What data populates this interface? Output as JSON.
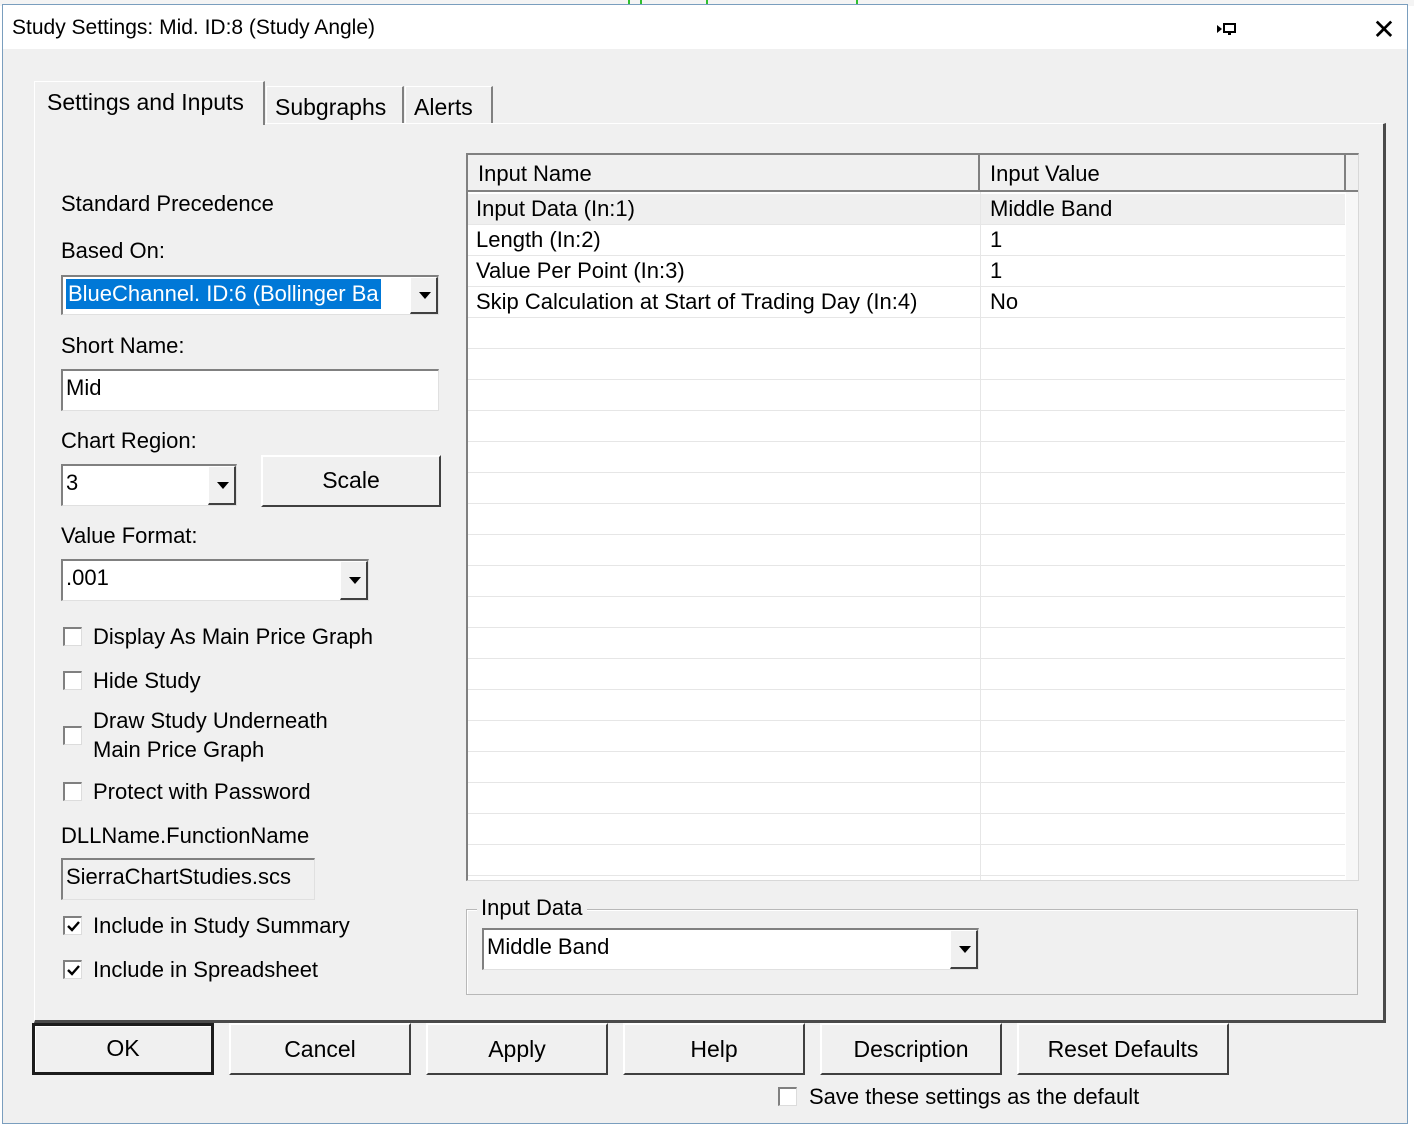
{
  "window": {
    "title": "Study Settings: Mid. ID:8 (Study Angle)"
  },
  "tabs": [
    {
      "label": "Settings and Inputs",
      "active": true
    },
    {
      "label": "Subgraphs",
      "active": false
    },
    {
      "label": "Alerts",
      "active": false
    }
  ],
  "left": {
    "precedence_label": "Standard Precedence",
    "based_on_label": "Based On:",
    "based_on_value": "BlueChannel. ID:6 (Bollinger Ba",
    "short_name_label": "Short Name:",
    "short_name_value": "Mid",
    "chart_region_label": "Chart Region:",
    "chart_region_value": "3",
    "scale_button": "Scale",
    "value_format_label": "Value Format:",
    "value_format_value": ".001",
    "checkboxes": [
      {
        "label": "Display As Main Price Graph",
        "checked": false
      },
      {
        "label": "Hide Study",
        "checked": false
      },
      {
        "label_line1": "Draw Study Underneath",
        "label_line2": "Main Price Graph",
        "checked": false
      },
      {
        "label": "Protect with Password",
        "checked": false
      }
    ],
    "dll_label": "DLLName.FunctionName",
    "dll_value": "SierraChartStudies.scs",
    "summary_checkboxes": [
      {
        "label": "Include in Study Summary",
        "checked": true
      },
      {
        "label": "Include in Spreadsheet",
        "checked": true
      }
    ]
  },
  "grid": {
    "columns": [
      "Input Name",
      "Input Value"
    ],
    "rows": [
      {
        "name": "Input Data   (In:1)",
        "value": "Middle Band"
      },
      {
        "name": "Length   (In:2)",
        "value": "1"
      },
      {
        "name": "Value Per Point   (In:3)",
        "value": "1"
      },
      {
        "name": "Skip Calculation at Start of Trading Day   (In:4)",
        "value": "No"
      }
    ]
  },
  "input_group": {
    "title": "Input Data",
    "value": "Middle Band"
  },
  "buttons": {
    "ok": "OK",
    "cancel": "Cancel",
    "apply": "Apply",
    "help": "Help",
    "description": "Description",
    "reset": "Reset Defaults"
  },
  "save_default": {
    "label": "Save these settings as the default",
    "checked": false
  }
}
